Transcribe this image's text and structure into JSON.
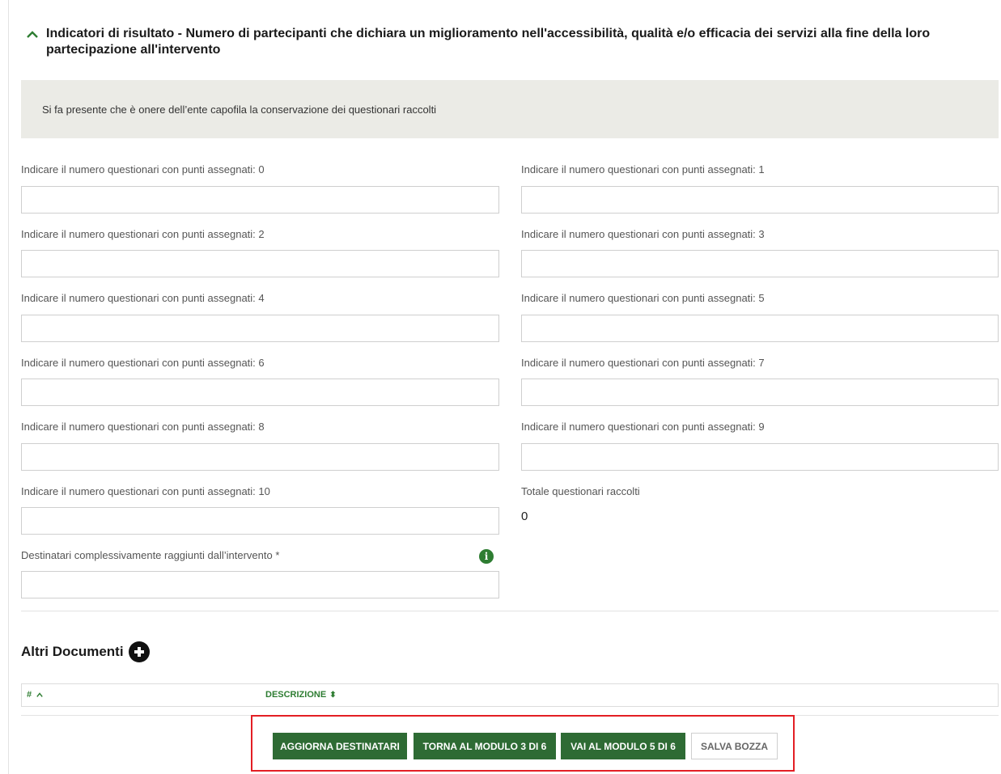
{
  "section": {
    "title": "Indicatori di risultato - Numero di partecipanti che dichiara un miglioramento nell'accessibilità, qualità e/o efficacia dei servizi alla fine della loro partecipazione all'intervento"
  },
  "notice": "Si fa presente che è onere dell’ente capofila la conservazione dei questionari raccolti",
  "fields": [
    {
      "label": "Indicare il numero questionari con punti assegnati: 0",
      "value": ""
    },
    {
      "label": "Indicare il numero questionari con punti assegnati: 1",
      "value": ""
    },
    {
      "label": "Indicare il numero questionari con punti assegnati: 2",
      "value": ""
    },
    {
      "label": "Indicare il numero questionari con punti assegnati: 3",
      "value": ""
    },
    {
      "label": "Indicare il numero questionari con punti assegnati: 4",
      "value": ""
    },
    {
      "label": "Indicare il numero questionari con punti assegnati: 5",
      "value": ""
    },
    {
      "label": "Indicare il numero questionari con punti assegnati: 6",
      "value": ""
    },
    {
      "label": "Indicare il numero questionari con punti assegnati: 7",
      "value": ""
    },
    {
      "label": "Indicare il numero questionari con punti assegnati: 8",
      "value": ""
    },
    {
      "label": "Indicare il numero questionari con punti assegnati: 9",
      "value": ""
    },
    {
      "label": "Indicare il numero questionari con punti assegnati: 10",
      "value": ""
    }
  ],
  "totale": {
    "label": "Totale questionari raccolti",
    "value": "0"
  },
  "destinatari": {
    "label": "Destinatari complessivamente raggiunti dall’intervento *",
    "value": ""
  },
  "info_icon": "info-circle-icon",
  "altri_documenti": {
    "title": "Altri Documenti",
    "add_icon": "plus-circle-icon",
    "columns": {
      "hash": "#",
      "descrizione": "DESCRIZIONE"
    }
  },
  "buttons": {
    "aggiorna": "AGGIORNA DESTINATARI",
    "torna": "TORNA AL MODULO 3 DI 6",
    "vai": "VAI AL MODULO 5 DI 6",
    "salva": "SALVA BOZZA"
  },
  "colors": {
    "accent": "#2e6b34",
    "highlight": "#e31e24",
    "notice_bg": "#ebebe6"
  }
}
